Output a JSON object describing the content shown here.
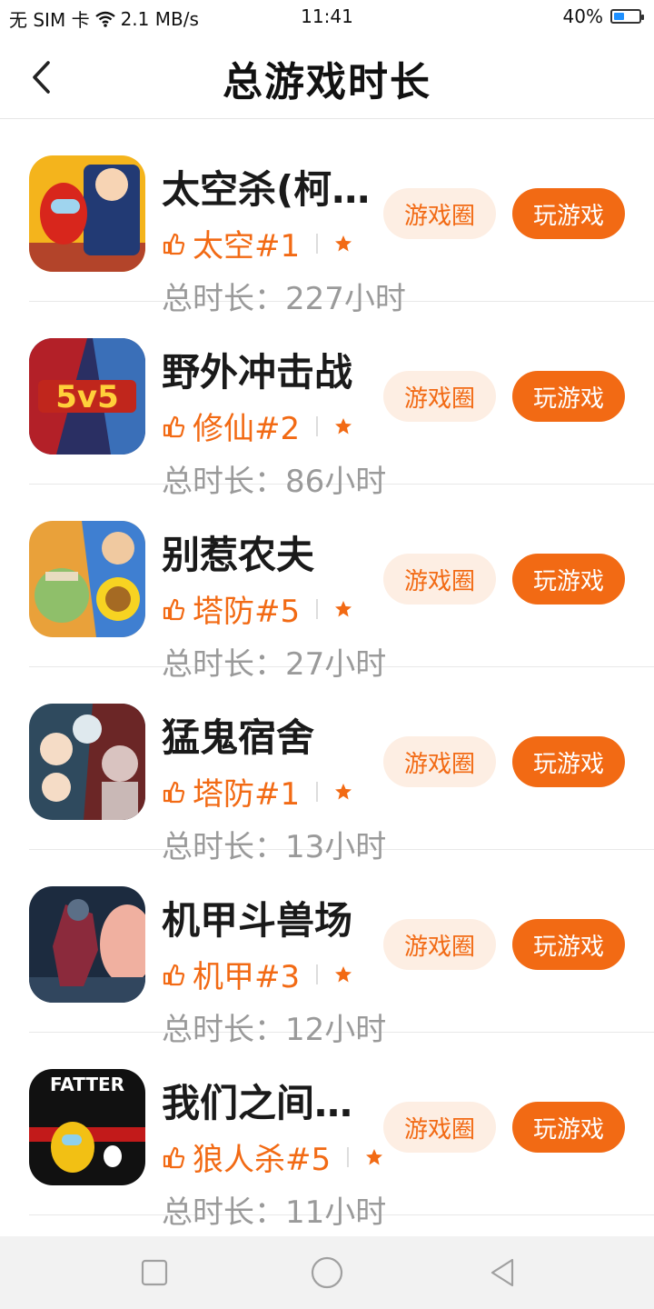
{
  "status_bar": {
    "carrier": "无 SIM 卡",
    "speed": "2.1 MB/s",
    "time": "11:41",
    "battery": "40%",
    "battery_level": 0.4
  },
  "header": {
    "title": "总游戏时长"
  },
  "buttons": {
    "circle_label": "游戏圈",
    "play_label": "玩游戏"
  },
  "colors": {
    "accent": "#f26a14",
    "accent_light": "#fdeee3"
  },
  "games": [
    {
      "name": "太空杀(柯…",
      "tag": "太空#1",
      "duration": "总时长：227小时",
      "icon": "among-us-conan-icon"
    },
    {
      "name": "野外冲击战",
      "tag": "修仙#2",
      "duration": "总时长：86小时",
      "icon": "5v5-battle-icon"
    },
    {
      "name": "别惹农夫",
      "tag": "塔防#5",
      "duration": "总时长：27小时",
      "icon": "zombie-sunflower-icon"
    },
    {
      "name": "猛鬼宿舍",
      "tag": "塔防#1",
      "duration": "总时长：13小时",
      "icon": "ghost-dorm-icon"
    },
    {
      "name": "机甲斗兽场",
      "tag": "机甲#3",
      "duration": "总时长：12小时",
      "icon": "mecha-icon"
    },
    {
      "name": "我们之间…",
      "tag": "狼人杀#5",
      "duration": "总时长：11小时",
      "icon": "fatter-icon",
      "icon_text": "FATTER"
    }
  ],
  "nav": {
    "home": "square-icon",
    "circle": "circle-icon",
    "back": "triangle-back-icon"
  }
}
